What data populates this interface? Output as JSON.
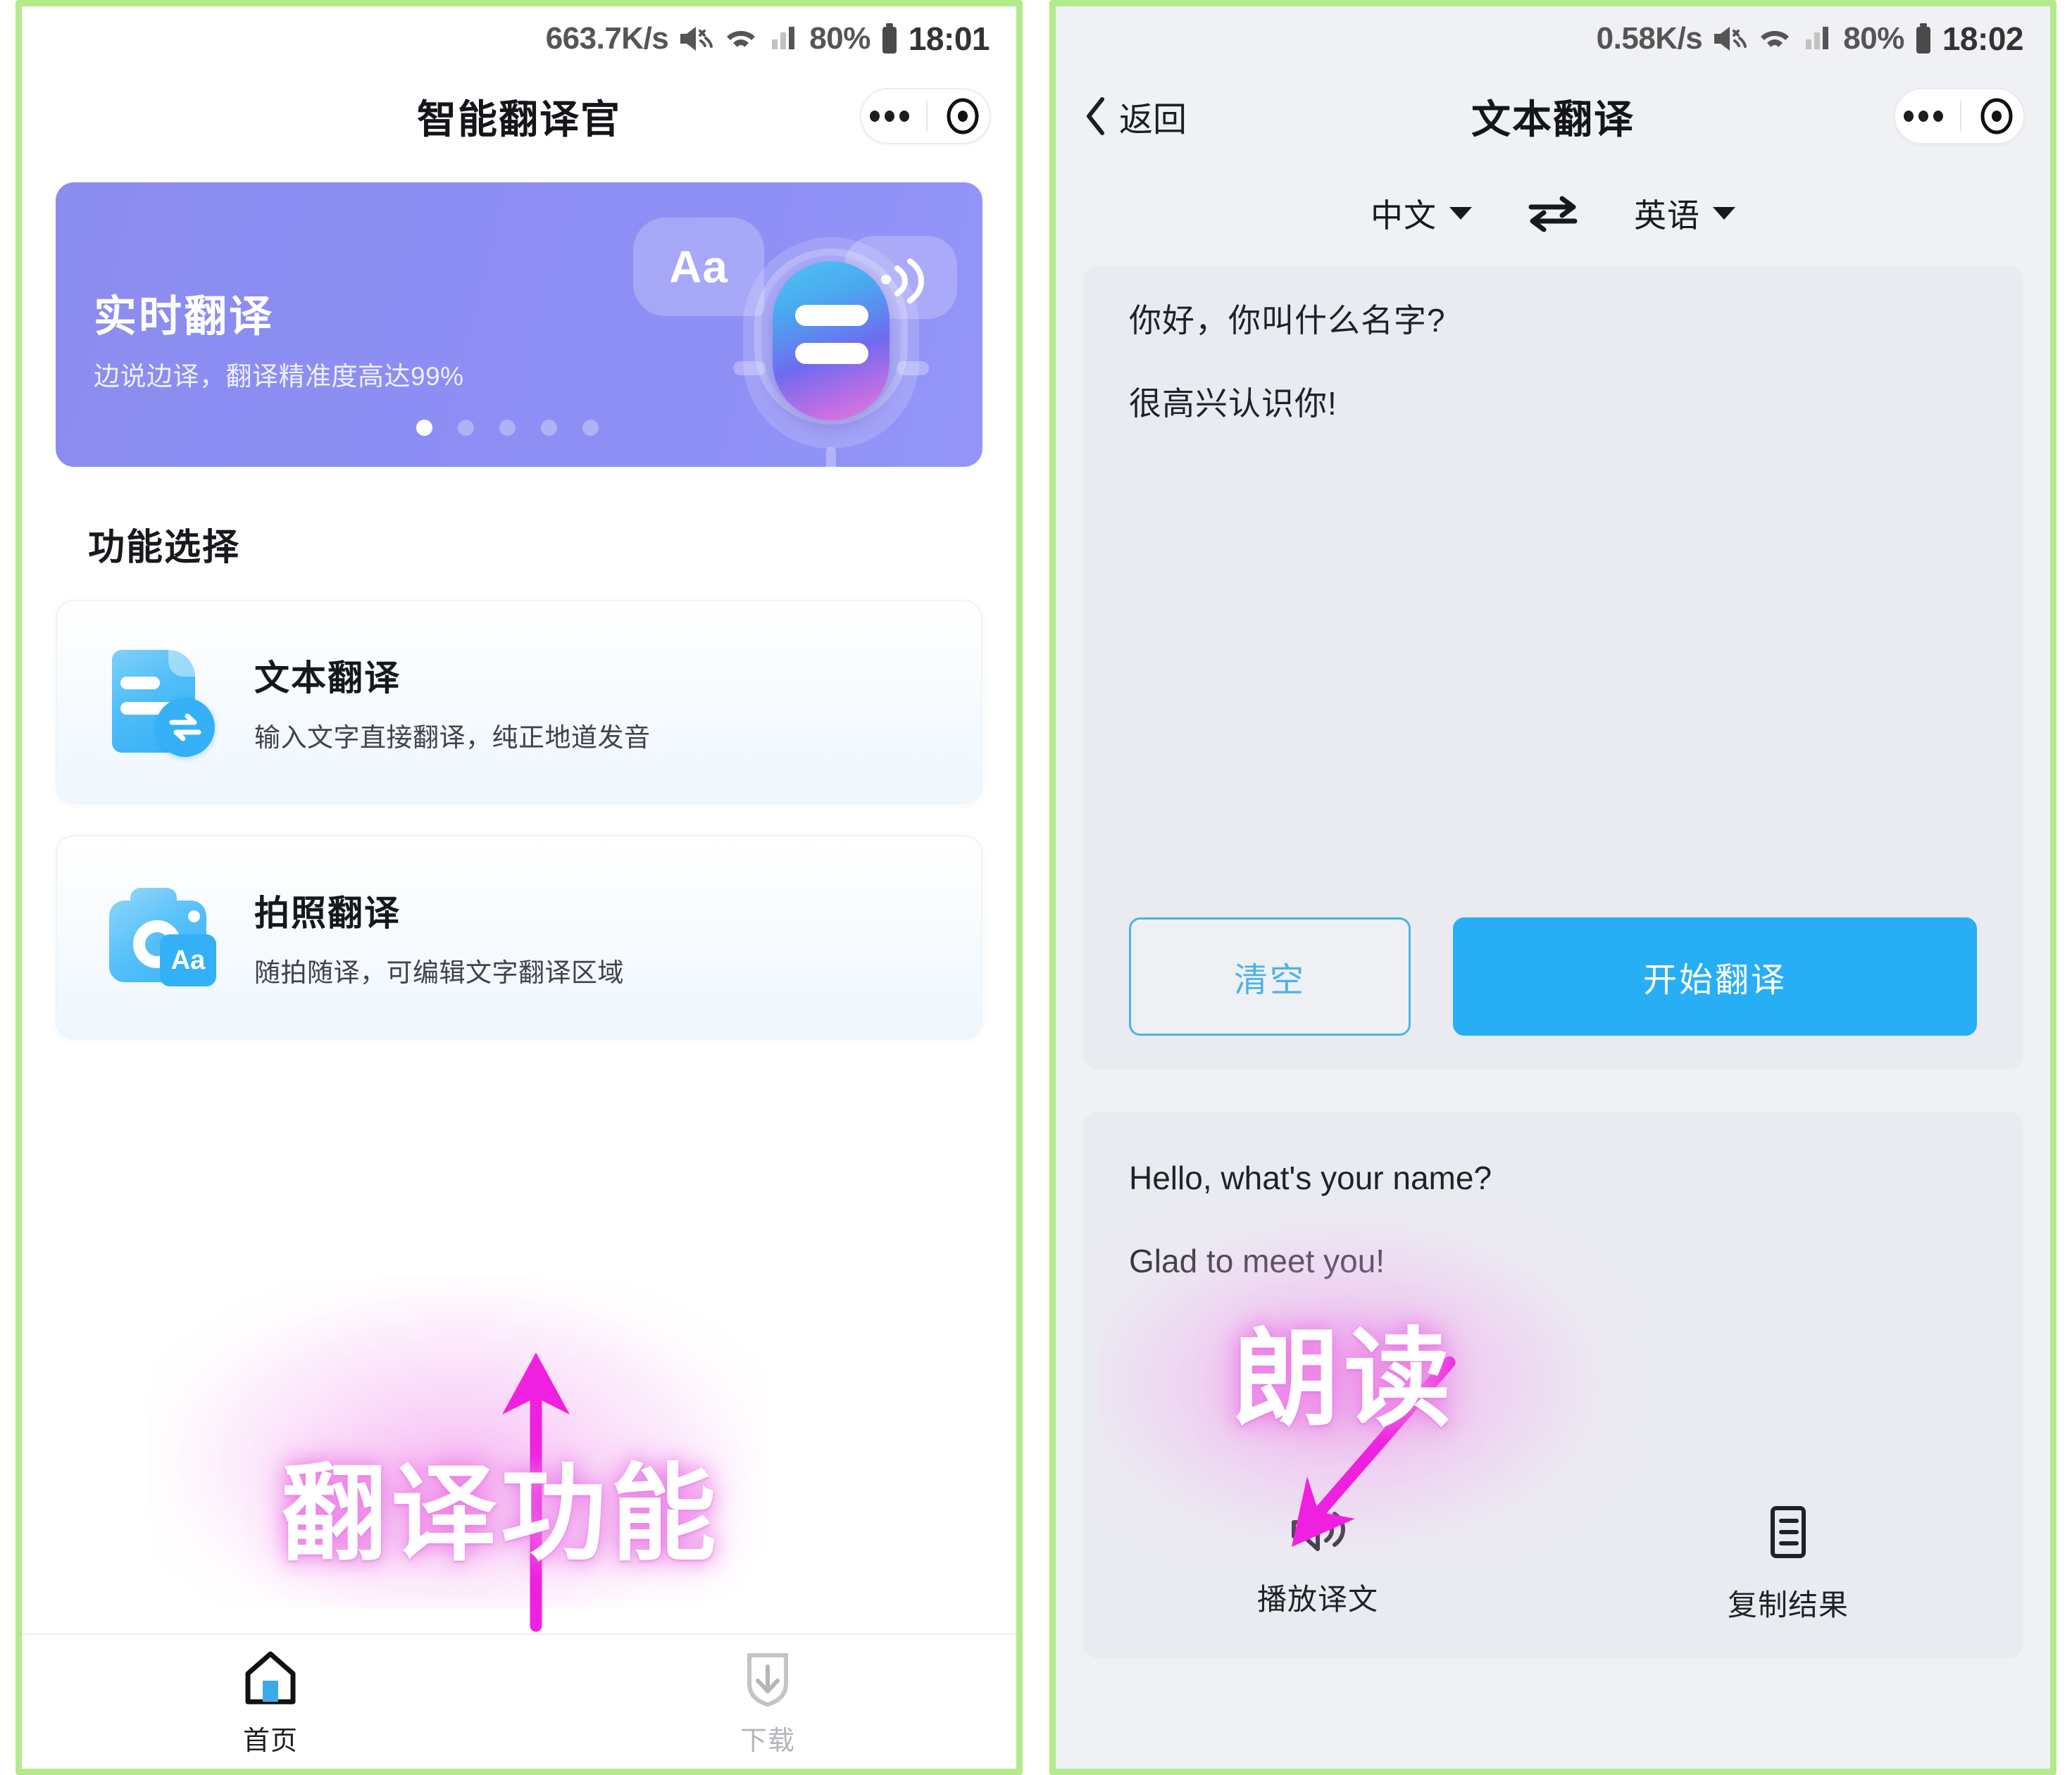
{
  "left": {
    "status": {
      "speed": "663.7K/s",
      "battery_pct": "80%",
      "time": "18:01"
    },
    "nav": {
      "title": "智能翻译官"
    },
    "banner": {
      "title": "实时翻译",
      "subtitle": "边说边译，翻译精准度高达99%",
      "art_aa_label": "Aa",
      "dot_count": 5,
      "active_dot": 1,
      "bg_color": "#8d8ef3"
    },
    "section_title": "功能选择",
    "features": [
      {
        "title": "文本翻译",
        "desc": "输入文字直接翻译，纯正地道发音",
        "icon": "document-translate-icon"
      },
      {
        "title": "拍照翻译",
        "desc": "随拍随译，可编辑文字翻译区域",
        "icon": "camera-translate-icon",
        "badge": "Aa"
      }
    ],
    "annotation": {
      "text": "翻译功能",
      "color": "#f020e0"
    },
    "tabs": [
      {
        "label": "首页",
        "icon": "home-icon",
        "active": true
      },
      {
        "label": "下载",
        "icon": "download-icon",
        "active": false
      }
    ]
  },
  "right": {
    "status": {
      "speed": "0.58K/s",
      "battery_pct": "80%",
      "time": "18:02"
    },
    "nav": {
      "back_label": "返回",
      "title": "文本翻译"
    },
    "lang": {
      "source": "中文",
      "target": "英语",
      "swap_icon": "swap-horizontal-icon"
    },
    "input": {
      "lines": [
        "你好，你叫什么名字?",
        "很高兴认识你!"
      ],
      "clear_label": "清空",
      "translate_label": "开始翻译",
      "accent_color": "#28aef5"
    },
    "result": {
      "lines": [
        "Hello, what's your name?",
        "Glad to meet you!"
      ],
      "actions": [
        {
          "label": "播放译文",
          "icon": "speaker-icon"
        },
        {
          "label": "复制结果",
          "icon": "copy-icon"
        }
      ]
    },
    "annotation": {
      "text": "朗读",
      "color": "#f020e0"
    }
  },
  "frame": {
    "border_color": "#b4ea8c"
  }
}
